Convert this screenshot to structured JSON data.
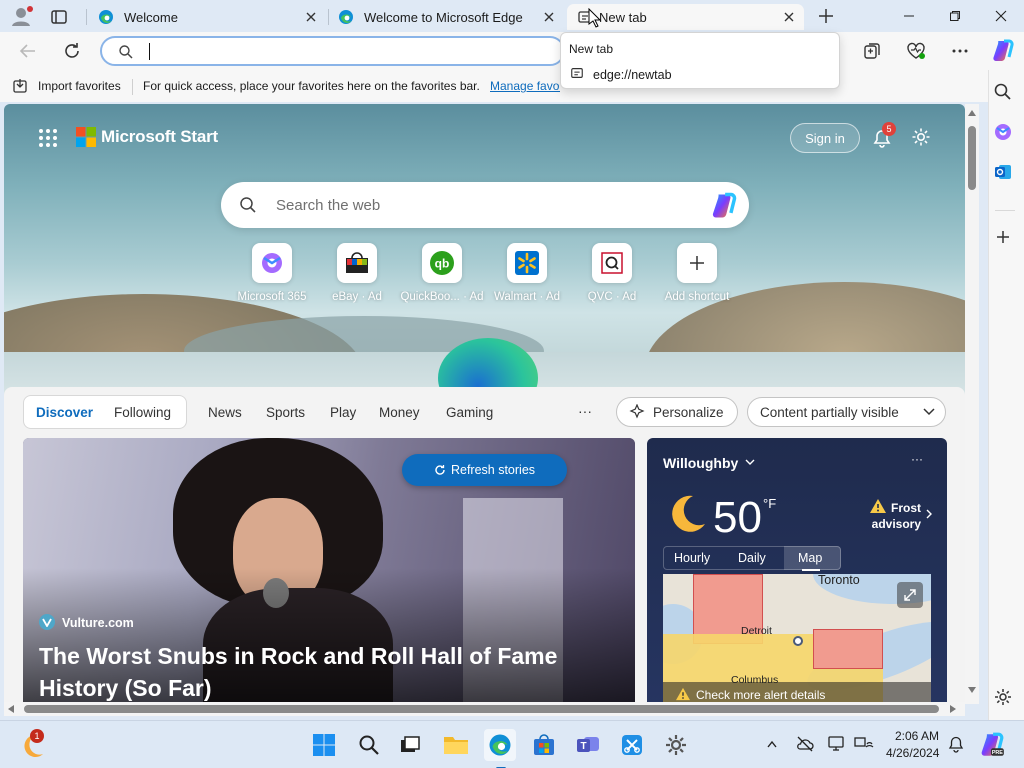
{
  "tabs": [
    {
      "title": "Welcome"
    },
    {
      "title": "Welcome to Microsoft Edge"
    },
    {
      "title": "New tab"
    }
  ],
  "address": {
    "value": "",
    "placeholder": ""
  },
  "dropdown": {
    "title": "New tab",
    "url": "edge://newtab"
  },
  "favorites": {
    "import_label": "Import favorites",
    "hint": "For quick access, place your favorites here on the favorites bar.",
    "manage_label": "Manage favorites now"
  },
  "start": {
    "brand": "Microsoft Start",
    "sign_in": "Sign in",
    "notif_count": "5",
    "search_placeholder": "Search the web",
    "quicklinks": [
      {
        "label": "Microsoft 365"
      },
      {
        "label": "eBay · Ad"
      },
      {
        "label": "QuickBoo... · Ad"
      },
      {
        "label": "Walmart · Ad"
      },
      {
        "label": "QVC · Ad"
      },
      {
        "label": "Add shortcut"
      }
    ]
  },
  "feed": {
    "tabs_primary": [
      "Discover",
      "Following"
    ],
    "tabs": [
      "News",
      "Sports",
      "Play",
      "Money",
      "Gaming"
    ],
    "more": "···",
    "personalize": "Personalize",
    "visibility": "Content partially visible",
    "refresh": "Refresh stories",
    "story": {
      "source": "Vulture.com",
      "headline": "The Worst Snubs in Rock and Roll Hall of Fame History (So Far)"
    }
  },
  "weather": {
    "location": "Willoughby",
    "temp": "50",
    "unit": "°F",
    "alert": "Frost advisory",
    "tabs": [
      "Hourly",
      "Daily",
      "Map"
    ],
    "map_labels": [
      "Toronto",
      "Detroit",
      "Columbus"
    ],
    "check_alerts": "Check more alert details",
    "more": "···"
  },
  "taskbar": {
    "time": "2:06 AM",
    "date": "4/26/2024",
    "badge": "1"
  },
  "colors": {
    "accent": "#0f6cbd",
    "tabstrip": "#dfe9f5",
    "weather_bg": "#1f2b4d"
  }
}
